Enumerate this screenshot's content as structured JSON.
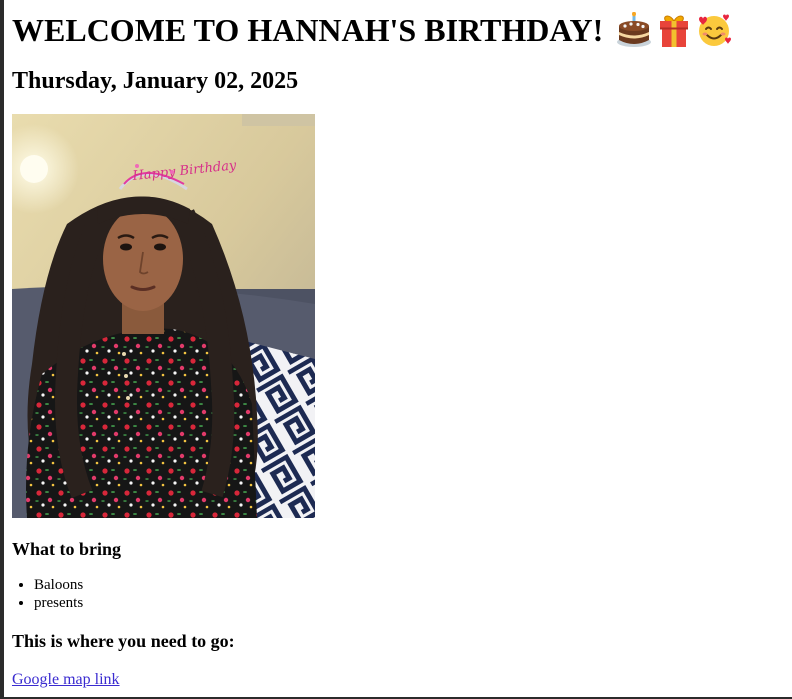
{
  "header": {
    "title": "WELCOME TO HANNAH'S BIRTHDAY!",
    "emojis": [
      "cake-icon",
      "gift-icon",
      "smiling-face-with-hearts-icon"
    ]
  },
  "date": "Thursday, January 02, 2025",
  "photo": {
    "tiara_text": "Happy Birthday"
  },
  "bring": {
    "heading": "What to bring",
    "items": [
      "Baloons",
      "presents"
    ]
  },
  "directions": {
    "heading": "This is where you need to go:",
    "link_label": "Google map link"
  },
  "colors": {
    "link": "#3a2bd0",
    "text": "#000000",
    "background": "#ffffff"
  }
}
